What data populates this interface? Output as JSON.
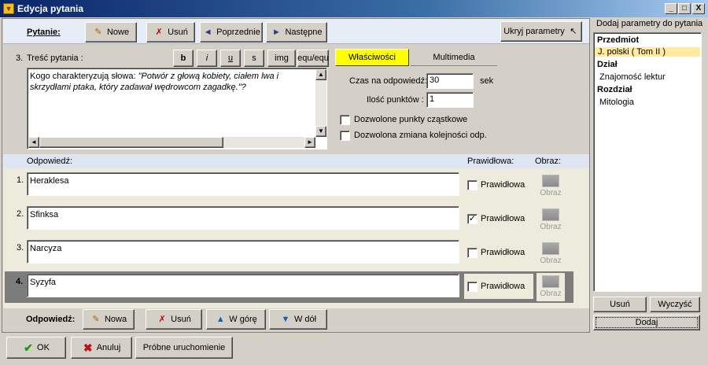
{
  "window": {
    "title": "Edycja pytania",
    "controls": {
      "minimize": "_",
      "maximize": "□",
      "close": "X"
    }
  },
  "toolbar": {
    "question_label": "Pytanie:",
    "new_label": "Nowe",
    "delete_label": "Usuń",
    "previous_label": "Poprzednie",
    "next_label": "Następne",
    "hide_params_label": "Ukryj parametry"
  },
  "question": {
    "number": "3.",
    "content_label": "Treść pytania :",
    "text_plain": "Kogo charakteryzują słowa: ",
    "text_quote": "\"Potwór z głową kobiety, ciałem lwa i skrzydłami ptaka, który zadawał wędrowcom zagadkę.\"?",
    "format_buttons": [
      "b",
      "i",
      "u",
      "s",
      "img",
      "equ/equ"
    ]
  },
  "properties": {
    "tabs": [
      "Właściwości",
      "Multimedia"
    ],
    "active_tab": "Właściwości",
    "time_label": "Czas na odpowiedź:",
    "time_value": "30",
    "time_unit": "sek",
    "points_label": "Ilość punktów :",
    "points_value": "1",
    "partial_points_label": "Dozwolone punkty cząstkowe",
    "partial_points_checked": false,
    "order_change_label": "Dozwolona zmiana kolejności odp.",
    "order_change_checked": false
  },
  "answers": {
    "header_answer": "Odpowiedź:",
    "header_correct": "Prawidłowa:",
    "header_image": "Obraz:",
    "correct_label": "Prawidłowa",
    "image_label": "Obraz",
    "items": [
      {
        "number": "1.",
        "text": "Heraklesa",
        "correct": false
      },
      {
        "number": "2.",
        "text": "Sfinksa",
        "correct": true
      },
      {
        "number": "3.",
        "text": "Narcyza",
        "correct": false
      },
      {
        "number": "4.",
        "text": "Syzyfa",
        "correct": false
      }
    ],
    "check_mark": "✓",
    "footer_label": "Odpowiedź:",
    "new_label": "Nowa",
    "delete_label": "Usuń",
    "up_label": "W górę",
    "down_label": "W dół"
  },
  "right_panel": {
    "title": "Dodaj parametry do pytania",
    "tree": [
      {
        "type": "header",
        "text": "Przedmiot"
      },
      {
        "type": "item",
        "text": "J. polski   ( Tom II )",
        "selected": true
      },
      {
        "type": "header",
        "text": "Dział"
      },
      {
        "type": "item",
        "text": "Znajomość lektur",
        "selected": false
      },
      {
        "type": "header",
        "text": "Rozdział"
      },
      {
        "type": "item",
        "text": "Mitologia",
        "selected": false
      }
    ],
    "delete_label": "Usuń",
    "clear_label": "Wyczyść",
    "add_label": "Dodaj"
  },
  "bottom": {
    "ok_label": "OK",
    "cancel_label": "Anuluj",
    "test_run_label": "Próbne uruchomienie"
  },
  "colors": {
    "title_bar": "#0a246a",
    "active_tab": "#ffff00",
    "selected_item": "#ffeaa0",
    "toolbar_band": "#e6edf6",
    "answers_area": "#ecebdc",
    "active_row": "#7c7c7c"
  }
}
